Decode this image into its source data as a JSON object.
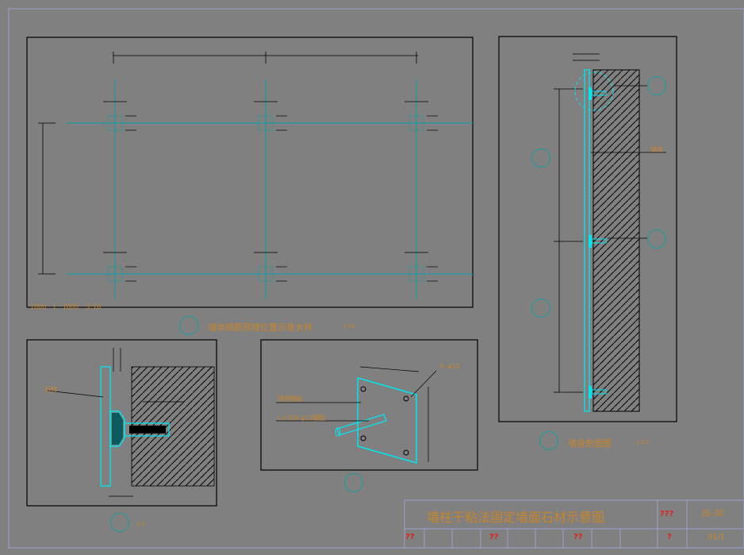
{
  "colors": {
    "background": "#808080",
    "frame": "#000000",
    "cyan": "#00e5ee",
    "teal": "#1a9aa0",
    "orange_text": "#c8852a",
    "red_text": "#e02020",
    "hatch": "#000000"
  },
  "panel_a": {
    "scale_note": "1000 · 1 · 1000 · ·1:10",
    "caption": "墙体钢筋预埋位置示意大样",
    "caption_scale": "1:10"
  },
  "panel_b": {
    "caption": "墙身剖面图",
    "caption_scale": "1:10",
    "note": "墙体"
  },
  "panel_c": {
    "label_left": "石材",
    "caption_scale": "1:5"
  },
  "panel_d": {
    "label_1": "预埋钢板",
    "label_2": "L=200  φ12钢筋",
    "label_3": "4- φ12"
  },
  "title_block": {
    "title": "墙柱干粘法固定墙面石材示意图",
    "field_a": "???",
    "drawing_no": "JS-30",
    "field_b": "??",
    "field_c": "??",
    "field_d": "??",
    "field_e": "?",
    "page": "01/1"
  }
}
